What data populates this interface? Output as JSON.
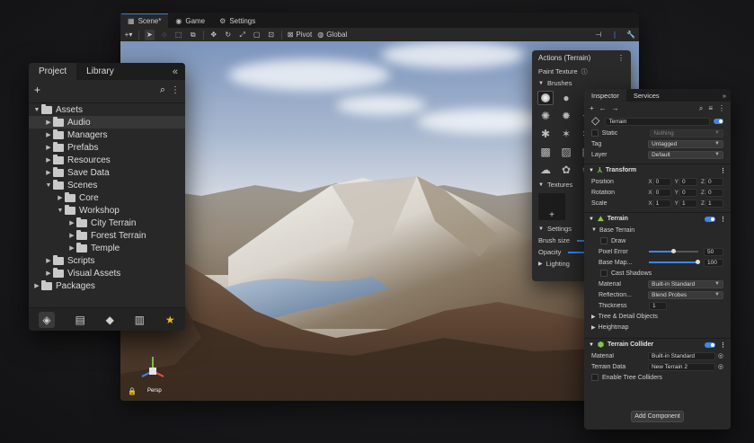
{
  "scene": {
    "tabs": [
      {
        "label": "Scene*",
        "icon": "grid-icon"
      },
      {
        "label": "Game",
        "icon": "gamepad-icon"
      },
      {
        "label": "Settings",
        "icon": "gear-icon"
      }
    ],
    "toolbar": {
      "pivot_label": "Pivot",
      "global_label": "Global"
    },
    "gizmo": {
      "persp_label": "Persp"
    }
  },
  "project": {
    "tabs": [
      "Project",
      "Library"
    ],
    "tree": [
      {
        "label": "Assets",
        "depth": 0,
        "expanded": true
      },
      {
        "label": "Audio",
        "depth": 1,
        "expanded": false,
        "selected": true
      },
      {
        "label": "Managers",
        "depth": 1,
        "expanded": false
      },
      {
        "label": "Prefabs",
        "depth": 1,
        "expanded": false
      },
      {
        "label": "Resources",
        "depth": 1,
        "expanded": false
      },
      {
        "label": "Save Data",
        "depth": 1,
        "expanded": false
      },
      {
        "label": "Scenes",
        "depth": 1,
        "expanded": true
      },
      {
        "label": "Core",
        "depth": 2,
        "expanded": false
      },
      {
        "label": "Workshop",
        "depth": 2,
        "expanded": true
      },
      {
        "label": "City Terrain",
        "depth": 3,
        "expanded": false
      },
      {
        "label": "Forest Terrain",
        "depth": 3,
        "expanded": false
      },
      {
        "label": "Temple",
        "depth": 3,
        "expanded": false
      },
      {
        "label": "Scripts",
        "depth": 1,
        "expanded": false
      },
      {
        "label": "Visual Assets",
        "depth": 1,
        "expanded": false
      },
      {
        "label": "Packages",
        "depth": 0,
        "expanded": false
      }
    ]
  },
  "actions": {
    "title": "Actions (Terrain)",
    "paint_texture": "Paint Texture",
    "brushes": "Brushes",
    "textures": "Textures",
    "settings": "Settings",
    "brush_size": "Brush size",
    "opacity": "Opacity",
    "lighting": "Lighting"
  },
  "inspector": {
    "tabs": [
      "Inspector",
      "Services"
    ],
    "object_name": "Terrain",
    "static_label": "Static",
    "static_value": "Nothing",
    "tag_label": "Tag",
    "tag_value": "Untagged",
    "layer_label": "Layer",
    "layer_value": "Default",
    "transform": {
      "title": "Transform",
      "rows": [
        {
          "label": "Position",
          "x": "0",
          "y": "0",
          "z": "0"
        },
        {
          "label": "Rotation",
          "x": "0",
          "y": "0",
          "z": "0"
        },
        {
          "label": "Scale",
          "x": "1",
          "y": "1",
          "z": "1"
        }
      ]
    },
    "terrain": {
      "title": "Terrain",
      "base_terrain": "Base Terrain",
      "draw": "Draw",
      "pixel_error_label": "Pixel Error",
      "pixel_error_value": "50",
      "pixel_error_fraction": 0.5,
      "base_map_label": "Base Map...",
      "base_map_value": "100",
      "base_map_fraction": 1.0,
      "cast_shadows": "Cast Shadows",
      "material_label": "Material",
      "material_value": "Built-in Standard",
      "reflection_label": "Reflection...",
      "reflection_value": "Blend Probes",
      "thickness_label": "Thickness",
      "thickness_value": "1",
      "tree_detail": "Tree & Detail Objects",
      "heightmap": "Heightmap"
    },
    "collider": {
      "title": "Terrain Collider",
      "material_label": "Material",
      "material_value": "Built-in Standard",
      "data_label": "Terrain Data",
      "data_value": "New Terrain 2",
      "tree_colliders": "Enable Tree Colliders"
    },
    "add_component": "Add Component"
  }
}
